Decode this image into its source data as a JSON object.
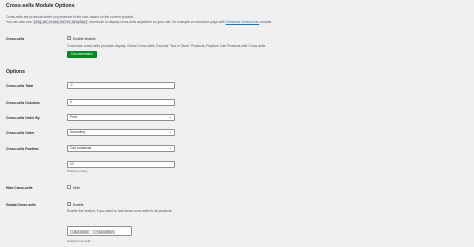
{
  "module": {
    "title": "Cross-sells Module Options",
    "desc_line1": "Cross-sells are products which you promote in the cart, based on the current product.",
    "desc_line2_pre": "You can also use",
    "shortcode": "[alg_wc_cross_sells_display]",
    "desc_line2_mid": "shortcode to display cross-sells anywhere on your site, for example on checkout page with",
    "desc_line2_link": "Checkout Custom Info",
    "desc_line2_post": "module."
  },
  "enable": {
    "label": "Cross-sells",
    "checkbox_label": "Enable Module",
    "checked": true,
    "description": "Customize cross-sells products display. Global Cross-sells; Exclude \"Not in Stock\" Products; Replace Cart Products with Cross-sells.",
    "doc_button": "Documentation"
  },
  "options": {
    "title": "Options",
    "total": {
      "label": "Cross-sells Total",
      "value": "-1"
    },
    "columns": {
      "label": "Cross-sells Columns",
      "value": "0"
    },
    "order_by": {
      "label": "Cross-sells Order By",
      "value": "Price"
    },
    "order": {
      "label": "Cross-sells Order",
      "value": "Ascending"
    },
    "position": {
      "label": "Cross-sells Position",
      "value": "Cart collaterals",
      "priority_value": "10",
      "priority_hint": "Position priority"
    },
    "hide": {
      "label": "Hide Cross-sells",
      "checkbox_label": "Hide",
      "checked": false
    },
    "global": {
      "label": "Global Cross-sells",
      "checkbox_label": "Enable",
      "checked": true,
      "description": "Enable the section, if you want to add same cross-sells to all products.",
      "field_label": "Global cross-sells",
      "tags": [
        "× Belt (6310)",
        "× T-Shirt (6547)"
      ]
    }
  },
  "colors": {
    "accent": "#2271b1",
    "button": "#008a20",
    "background": "#f0f0f1"
  }
}
